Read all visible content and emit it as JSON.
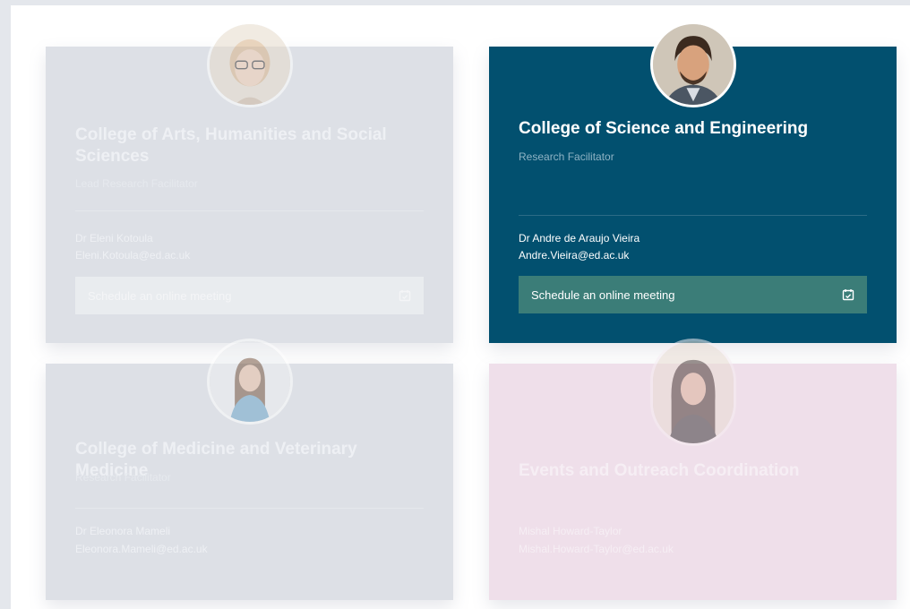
{
  "cards": [
    {
      "title": "College of Arts, Humanities and Social Sciences",
      "role": "Lead Research Facilitator",
      "name": "Dr Eleni Kotoula",
      "email": "Eleni.Kotoula@ed.ac.uk",
      "button": "Schedule an online meeting",
      "state": "faded"
    },
    {
      "title": "College of Science and Engineering",
      "role": "Research Facilitator",
      "name": "Dr Andre de Araujo Vieira",
      "email": "Andre.Vieira@ed.ac.uk",
      "button": "Schedule an online meeting",
      "state": "active"
    },
    {
      "title": "College of Medicine and Veterinary Medicine",
      "role": "Research Facilitator",
      "name": "Dr Eleonora Mameli",
      "email": "Eleonora.Mameli@ed.ac.uk",
      "state": "faded"
    },
    {
      "title": "Events and Outreach Coordination",
      "name": "Mishal Howard-Taylor",
      "email": "Mishal.Howard-Taylor@ed.ac.uk",
      "state": "faded"
    }
  ],
  "colors": {
    "page_bg": "#e4e7ec",
    "active_card": "#02506f",
    "active_button": "#3b7d78",
    "faded_card": "#dde0e6",
    "pink_card": "#efdfea"
  },
  "icons": {
    "meeting_button": "calendar-check-icon"
  }
}
